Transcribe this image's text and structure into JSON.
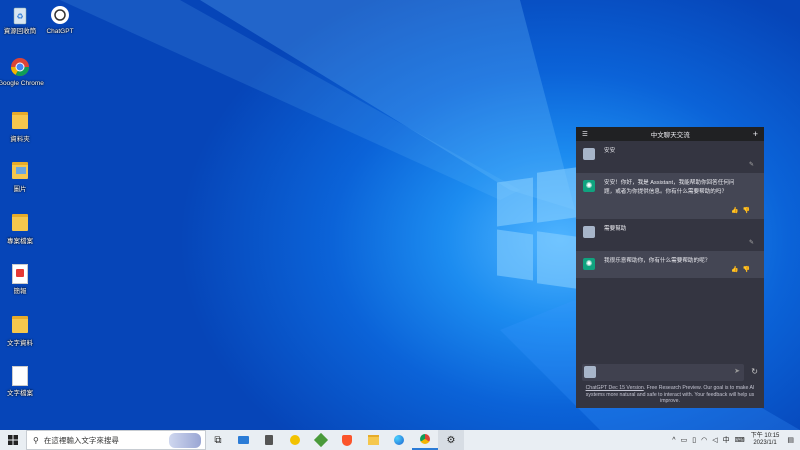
{
  "desktop": {
    "icons": [
      {
        "label": "資源回收筒",
        "icon": "recycle-bin-icon"
      },
      {
        "label": "ChatGPT",
        "icon": "chatgpt-icon"
      },
      {
        "label": "Google Chrome",
        "icon": "chrome-icon"
      },
      {
        "label": "資料夾",
        "icon": "folder-icon"
      },
      {
        "label": "圖片",
        "icon": "picture-folder-icon"
      },
      {
        "label": "專案檔案",
        "icon": "folder-icon"
      },
      {
        "label": "簡報",
        "icon": "pdf-icon"
      },
      {
        "label": "文字資料",
        "icon": "folder-icon"
      },
      {
        "label": "文字檔案",
        "icon": "text-file-icon"
      }
    ]
  },
  "chat": {
    "header_title": "中文聊天交流",
    "messages": [
      {
        "role": "user",
        "text": "安安"
      },
      {
        "role": "assistant",
        "text": "安安！你好，我是 Assistant，我能帮助你回答任何问题，或者为你提供信息。你有什么需要帮助的吗？"
      },
      {
        "role": "user",
        "text": "需要幫助"
      },
      {
        "role": "assistant",
        "text": "我很乐意帮助你，你有什么需要帮助的呢？"
      }
    ],
    "input_value": "",
    "footer_link": "ChatGPT Dec 15 Version",
    "footer_text": ". Free Research Preview. Our goal is to make AI systems more natural and safe to interact with. Your feedback will help us improve."
  },
  "taskbar": {
    "search_placeholder": "在這裡輸入文字來搜尋",
    "time": "下午 10:15",
    "date": "2023/1/1",
    "ime": "中",
    "apps": [
      "task-view-icon",
      "screen-icon",
      "calculator-icon",
      "chat-app-icon",
      "game-icon",
      "brave-icon",
      "file-explorer-icon",
      "edge-icon",
      "chrome-icon",
      "settings-icon"
    ]
  },
  "colors": {
    "accent": "#10a37f",
    "chat_bg": "#343541",
    "bot_bg": "#444654",
    "desktop": "#0b63d8"
  }
}
